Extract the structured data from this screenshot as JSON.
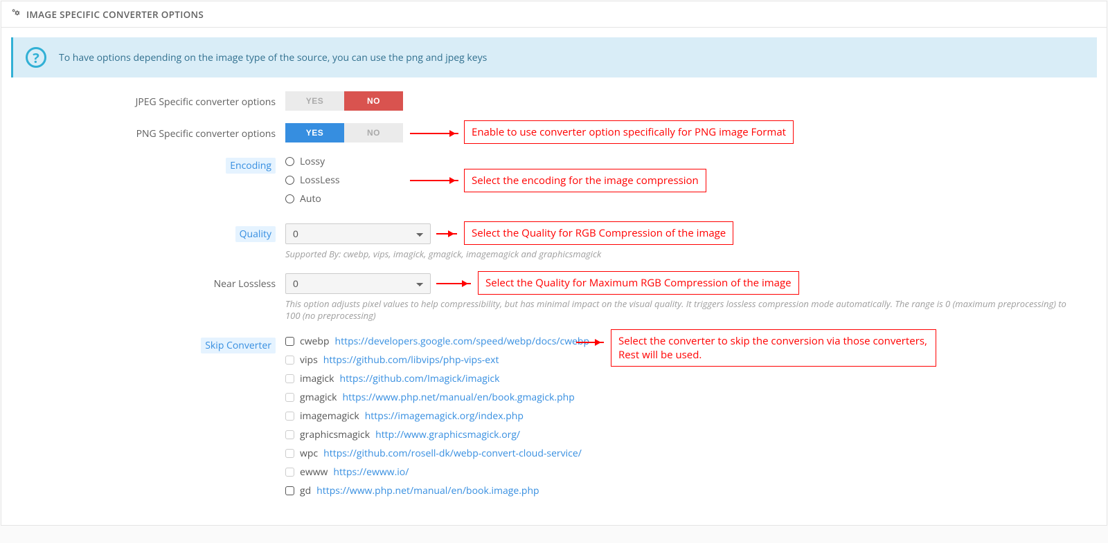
{
  "panel": {
    "title": "IMAGE SPECIFIC CONVERTER OPTIONS",
    "info": "To have options depending on the image type of the source, you can use the png and jpeg keys"
  },
  "jpeg": {
    "label": "JPEG Specific converter options",
    "yes": "YES",
    "no": "NO"
  },
  "png": {
    "label": "PNG Specific converter options",
    "yes": "YES",
    "no": "NO"
  },
  "encoding": {
    "label": "Encoding",
    "options": [
      "Lossy",
      "LossLess",
      "Auto"
    ]
  },
  "quality": {
    "label": "Quality",
    "value": "0",
    "help": "Supported By: cwebp, vips, imagick, gmagick, imagemagick and graphicsmagick"
  },
  "near_lossless": {
    "label": "Near Lossless",
    "value": "0",
    "help": "This option adjusts pixel values to help compressibility, but has minimal impact on the visual quality. It triggers lossless compression mode automatically. The range is 0 (maximum preprocessing) to 100 (no preprocessing)"
  },
  "skip": {
    "label": "Skip Converter",
    "items": [
      {
        "name": "cwebp",
        "url": "https://developers.google.com/speed/webp/docs/cwebp",
        "enabled": true
      },
      {
        "name": "vips",
        "url": "https://github.com/libvips/php-vips-ext",
        "enabled": false
      },
      {
        "name": "imagick",
        "url": "https://github.com/Imagick/imagick",
        "enabled": false
      },
      {
        "name": "gmagick",
        "url": "https://www.php.net/manual/en/book.gmagick.php",
        "enabled": false
      },
      {
        "name": "imagemagick",
        "url": "https://imagemagick.org/index.php",
        "enabled": false
      },
      {
        "name": "graphicsmagick",
        "url": "http://www.graphicsmagick.org/",
        "enabled": false
      },
      {
        "name": "wpc",
        "url": "https://github.com/rosell-dk/webp-convert-cloud-service/",
        "enabled": false
      },
      {
        "name": "ewww",
        "url": "https://ewww.io/",
        "enabled": false
      },
      {
        "name": "gd",
        "url": "https://www.php.net/manual/en/book.image.php",
        "enabled": true
      }
    ]
  },
  "annotations": {
    "png": "Enable to use converter option specifically for PNG image Format",
    "encoding": "Select the encoding for the image compression",
    "quality": "Select the Quality for RGB Compression of the image",
    "near_lossless": "Select the Quality for Maximum RGB Compression of the image",
    "skip": "Select the converter to skip the conversion via those converters, Rest will be used."
  }
}
